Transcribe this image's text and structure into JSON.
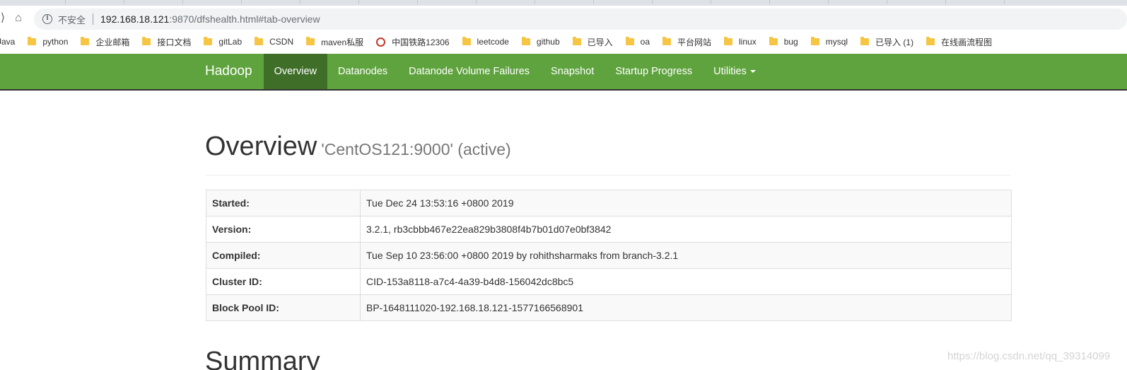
{
  "browser": {
    "insecure_label": "不安全",
    "url_host": "192.168.18.121",
    "url_rest": ":9870/dfshealth.html#tab-overview"
  },
  "bookmarks": [
    {
      "label": "Java",
      "icon": "folder-icon"
    },
    {
      "label": "python",
      "icon": "folder-icon"
    },
    {
      "label": "企业邮箱",
      "icon": "folder-icon"
    },
    {
      "label": "接口文档",
      "icon": "folder-icon"
    },
    {
      "label": "gitLab",
      "icon": "folder-icon"
    },
    {
      "label": "CSDN",
      "icon": "folder-icon"
    },
    {
      "label": "maven私服",
      "icon": "folder-icon"
    },
    {
      "label": "中国铁路12306",
      "icon": "railway-icon"
    },
    {
      "label": "leetcode",
      "icon": "folder-icon"
    },
    {
      "label": "github",
      "icon": "folder-icon"
    },
    {
      "label": "已导入",
      "icon": "folder-icon"
    },
    {
      "label": "oa",
      "icon": "folder-icon"
    },
    {
      "label": "平台网站",
      "icon": "folder-icon"
    },
    {
      "label": "linux",
      "icon": "folder-icon"
    },
    {
      "label": "bug",
      "icon": "folder-icon"
    },
    {
      "label": "mysql",
      "icon": "folder-icon"
    },
    {
      "label": "已导入 (1)",
      "icon": "folder-icon"
    },
    {
      "label": "在线画流程图",
      "icon": "folder-icon"
    }
  ],
  "navbar": {
    "brand": "Hadoop",
    "items": [
      "Overview",
      "Datanodes",
      "Datanode Volume Failures",
      "Snapshot",
      "Startup Progress",
      "Utilities"
    ],
    "active_index": 0,
    "color": "#5fa33e",
    "active_color": "#3e6e28"
  },
  "overview": {
    "title": "Overview",
    "subtitle": "'CentOS121:9000' (active)",
    "rows": [
      {
        "key": "Started:",
        "value": "Tue Dec 24 13:53:16 +0800 2019"
      },
      {
        "key": "Version:",
        "value": "3.2.1, rb3cbbb467e22ea829b3808f4b7b01d07e0bf3842"
      },
      {
        "key": "Compiled:",
        "value": "Tue Sep 10 23:56:00 +0800 2019 by rohithsharmaks from branch-3.2.1"
      },
      {
        "key": "Cluster ID:",
        "value": "CID-153a8118-a7c4-4a39-b4d8-156042dc8bc5"
      },
      {
        "key": "Block Pool ID:",
        "value": "BP-1648111020-192.168.18.121-1577166568901"
      }
    ]
  },
  "summary": {
    "title": "Summary"
  },
  "watermark": "https://blog.csdn.net/qq_39314099"
}
